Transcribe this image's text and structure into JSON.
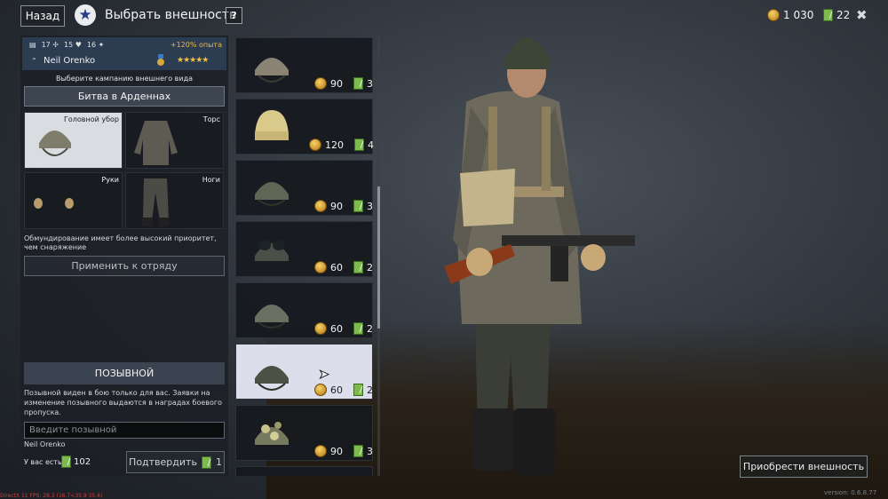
{
  "header": {
    "back_label": "Назад",
    "title": "Выбрать внешность",
    "help_label": "?",
    "gold": "1 030",
    "tickets": "22",
    "close_label": "✖"
  },
  "soldier": {
    "stat1": "17",
    "stat2": "15",
    "stat3": "16",
    "xp_bonus": "+120% опыта",
    "name": "Neil Orenko",
    "stars": "★★★★★"
  },
  "campaign": {
    "hint": "Выберите кампанию внешнего вида",
    "selected": "Битва в Арденнах"
  },
  "slots": {
    "head": "Головной убор",
    "torso": "Торс",
    "hands": "Руки",
    "legs": "Ноги"
  },
  "priority_hint": "Обмундирование имеет более высокий приоритет, чем снаряжение",
  "apply_label": "Применить к отряду",
  "callsign": {
    "header": "ПОЗЫВНОЙ",
    "description": "Позывной виден в бою только для вас. Заявки на изменение позывного выдаются в наградах боевого пропуска.",
    "placeholder": "Введите позывной",
    "current": "Neil Orenko",
    "have_label": "У вас есть",
    "have_value": "102",
    "confirm_label": "Подтвердить",
    "confirm_cost": "1"
  },
  "items": [
    {
      "gold": "90",
      "tickets": "3"
    },
    {
      "gold": "120",
      "tickets": "4"
    },
    {
      "gold": "90",
      "tickets": "3"
    },
    {
      "gold": "60",
      "tickets": "2"
    },
    {
      "gold": "60",
      "tickets": "2"
    },
    {
      "gold": "60",
      "tickets": "2"
    },
    {
      "gold": "90",
      "tickets": "3"
    }
  ],
  "purchase_label": "Приобрести внешность",
  "version": "version: 0.6.8.77",
  "fps": "DirectX 11 FPS: 28.3 (16.7<35.9 35.4)"
}
